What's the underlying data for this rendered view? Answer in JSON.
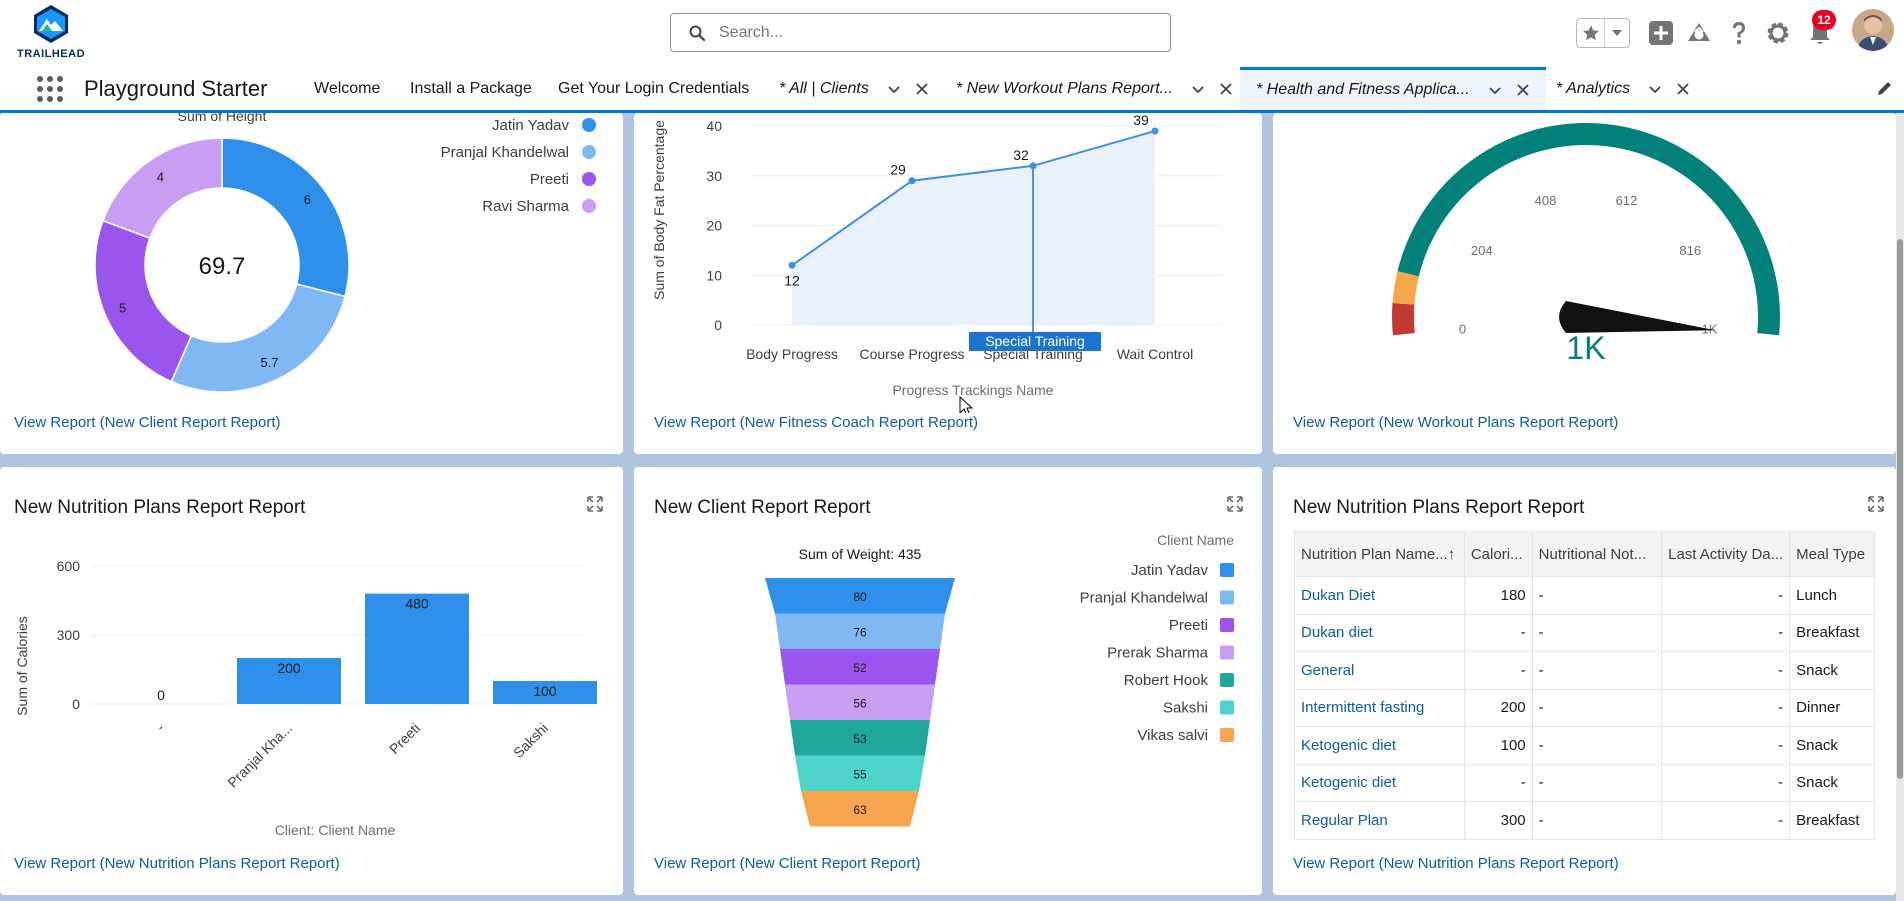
{
  "header": {
    "logo_text": "TRAILHEAD",
    "search_placeholder": "Search...",
    "notification_count": "12"
  },
  "nav": {
    "app_name": "Playground Starter",
    "tabs": [
      {
        "label": "Welcome"
      },
      {
        "label": "Install a Package"
      },
      {
        "label": "Get Your Login Credentials"
      },
      {
        "label": "* All | Clients"
      },
      {
        "label": "* New Workout Plans Report..."
      },
      {
        "label": "* Health and Fitness Applica..."
      },
      {
        "label": "* Analytics"
      }
    ]
  },
  "cards": {
    "donut": {
      "subtitle": "Sum of Height",
      "center_value": "69.7",
      "view_link": "View Report (New Client Report Report)",
      "chart_data": {
        "type": "pie",
        "title": "Sum of Height",
        "total": 69.7,
        "slices": [
          {
            "name": "Jatin Yadav",
            "value": 6,
            "color": "#2e90ea"
          },
          {
            "name": "Pranjal Khandelwal",
            "value": 5.7,
            "color": "#80b8f3"
          },
          {
            "name": "Preeti",
            "value": 5,
            "color": "#9955ec"
          },
          {
            "name": "Ravi Sharma",
            "value": 4,
            "color": "#c79ef2"
          }
        ]
      }
    },
    "line": {
      "view_link": "View Report (New Fitness Coach Report Report)",
      "tooltip": "Special Training",
      "chart_data": {
        "type": "line",
        "categories": [
          "Body Progress",
          "Course Progress",
          "Special Training",
          "Wait Control"
        ],
        "values": [
          12,
          29,
          32,
          39
        ],
        "xlabel": "Progress Trackings Name",
        "ylabel": "Sum of Body Fat Percentage",
        "ylim": [
          0,
          40
        ],
        "yticks": [
          0,
          10,
          20,
          30,
          40
        ],
        "color": "#3b91e0"
      }
    },
    "gauge": {
      "value_label": "1K",
      "view_link": "View Report (New Workout Plans Report Report)",
      "chart_data": {
        "type": "gauge",
        "value": 1020,
        "range": [
          0,
          1020
        ],
        "ticks": [
          "0",
          "204",
          "408",
          "612",
          "816",
          "1K"
        ],
        "bands": [
          {
            "to": 0.05,
            "color": "#c23934"
          },
          {
            "to": 0.1,
            "color": "#f4a84a"
          },
          {
            "to": 1,
            "color": "#04807a"
          }
        ]
      }
    },
    "bar": {
      "title": "New Nutrition Plans Report Report",
      "view_link": "View Report (New Nutrition Plans Report Report)",
      "chart_data": {
        "type": "bar",
        "categories": [
          "-",
          "Pranjal Kha...",
          "Preeti",
          "Sakshi"
        ],
        "values": [
          0,
          200,
          480,
          100
        ],
        "xlabel": "Client: Client Name",
        "ylabel": "Sum of Calories",
        "ylim": [
          0,
          600
        ],
        "yticks": [
          0,
          300,
          600
        ],
        "color": "#2e90ea"
      }
    },
    "funnel": {
      "title": "New Client Report Report",
      "view_link": "View Report (New Client Report Report)",
      "legend_title": "Client Name",
      "chart_data": {
        "type": "funnel",
        "title": "Sum of Weight: 435",
        "slices": [
          {
            "name": "Jatin Yadav",
            "value": 80,
            "color": "#2e90ea"
          },
          {
            "name": "Pranjal Khandelwal",
            "value": 76,
            "color": "#80b8f3"
          },
          {
            "name": "Preeti",
            "value": 52,
            "color": "#9955ec"
          },
          {
            "name": "Prerak Sharma",
            "value": 56,
            "color": "#c79ef2"
          },
          {
            "name": "Robert Hook",
            "value": 53,
            "color": "#1fa89a"
          },
          {
            "name": "Sakshi",
            "value": 55,
            "color": "#4ed3cc"
          },
          {
            "name": "Vikas salvi",
            "value": 63,
            "color": "#f7a54e"
          }
        ]
      }
    },
    "table": {
      "title": "New Nutrition Plans Report Report",
      "view_link": "View Report (New Nutrition Plans Report Report)",
      "columns": [
        "Nutrition Plan Name",
        "Calori...",
        "Nutritional Not...",
        "Last Activity Da...",
        "Meal Type"
      ],
      "rows": [
        [
          "Dukan Diet",
          "180",
          "-",
          "-",
          "Lunch"
        ],
        [
          "Dukan diet",
          "-",
          "-",
          "-",
          "Breakfast"
        ],
        [
          "General",
          "-",
          "-",
          "-",
          "Snack"
        ],
        [
          "Intermittent fasting",
          "200",
          "-",
          "-",
          "Dinner"
        ],
        [
          "Ketogenic diet",
          "100",
          "-",
          "-",
          "Snack"
        ],
        [
          "Ketogenic diet",
          "-",
          "-",
          "-",
          "Snack"
        ],
        [
          "Regular Plan",
          "300",
          "-",
          "-",
          "Breakfast"
        ]
      ]
    }
  }
}
